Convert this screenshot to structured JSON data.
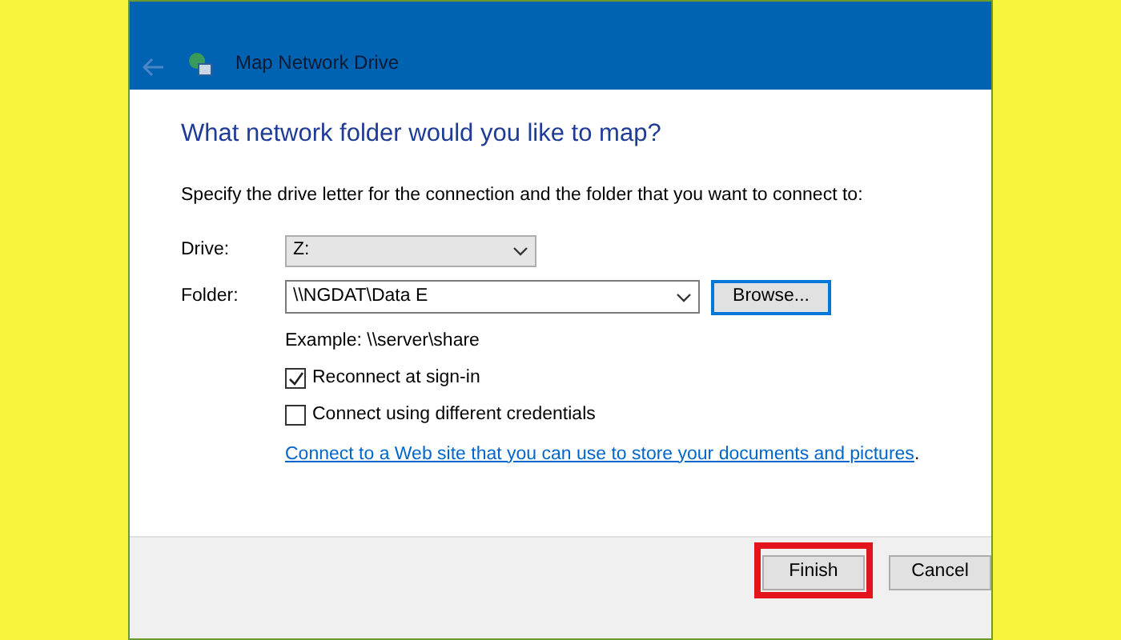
{
  "window": {
    "title": "Map Network Drive"
  },
  "heading": "What network folder would you like to map?",
  "instruction": "Specify the drive letter for the connection and the folder that you want to connect to:",
  "drive": {
    "label": "Drive:",
    "value": "Z:"
  },
  "folder": {
    "label": "Folder:",
    "value": "\\\\NGDAT\\Data E",
    "browse": "Browse..."
  },
  "example": "Example: \\\\server\\share",
  "options": [
    {
      "label": "Reconnect at sign-in",
      "checked": true
    },
    {
      "label": "Connect using different credentials",
      "checked": false
    }
  ],
  "link": "Connect to a Web site that you can use to store your documents and pictures",
  "link_suffix": ".",
  "buttons": [
    {
      "label": "Finish",
      "highlighted": true
    },
    {
      "label": "Cancel",
      "highlighted": false
    }
  ]
}
